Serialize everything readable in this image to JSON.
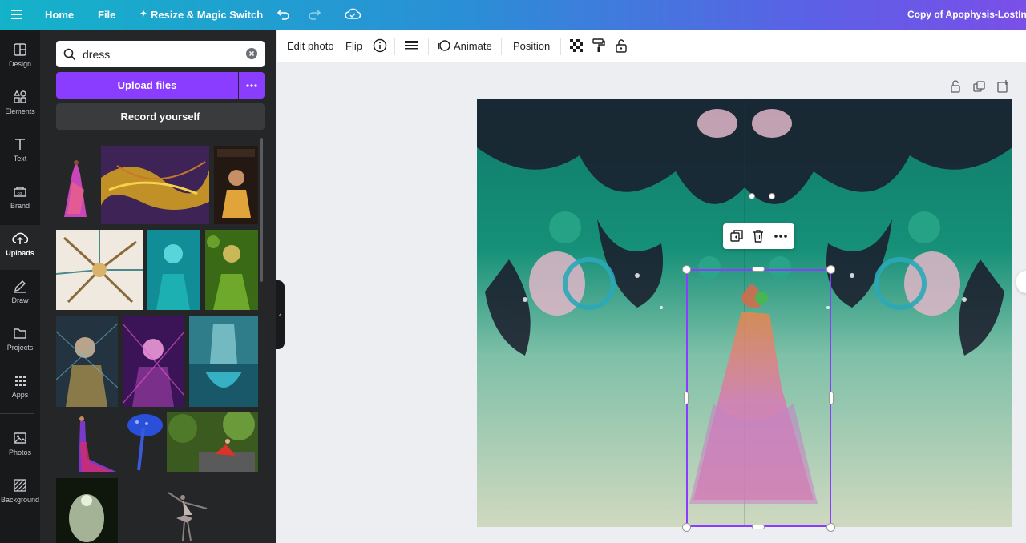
{
  "topbar": {
    "menu_icon": "hamburger-icon",
    "home": "Home",
    "file": "File",
    "resize": "Resize & Magic Switch",
    "undo_icon": "undo-icon",
    "redo_icon": "redo-icon",
    "cloud_icon": "cloud-saved-icon",
    "doc_title": "Copy of Apophysis-LostInA"
  },
  "rail": [
    {
      "label": "Design",
      "icon": "layout-icon"
    },
    {
      "label": "Elements",
      "icon": "shapes-icon"
    },
    {
      "label": "Text",
      "icon": "text-icon"
    },
    {
      "label": "Brand",
      "icon": "brand-icon"
    },
    {
      "label": "Uploads",
      "icon": "upload-cloud-icon"
    },
    {
      "label": "Draw",
      "icon": "pen-icon"
    },
    {
      "label": "Projects",
      "icon": "folder-icon"
    },
    {
      "label": "Apps",
      "icon": "apps-grid-icon"
    },
    {
      "label": "Photos",
      "icon": "photo-icon"
    },
    {
      "label": "Background",
      "icon": "background-hatch-icon"
    }
  ],
  "panel": {
    "search_value": "dress",
    "upload_label": "Upload files",
    "record_label": "Record yourself"
  },
  "toolbar": {
    "edit_photo": "Edit photo",
    "flip": "Flip",
    "animate": "Animate",
    "position": "Position"
  },
  "colors": {
    "accent": "#8b3dff",
    "rail_bg": "#18191b",
    "panel_bg": "#252627"
  }
}
